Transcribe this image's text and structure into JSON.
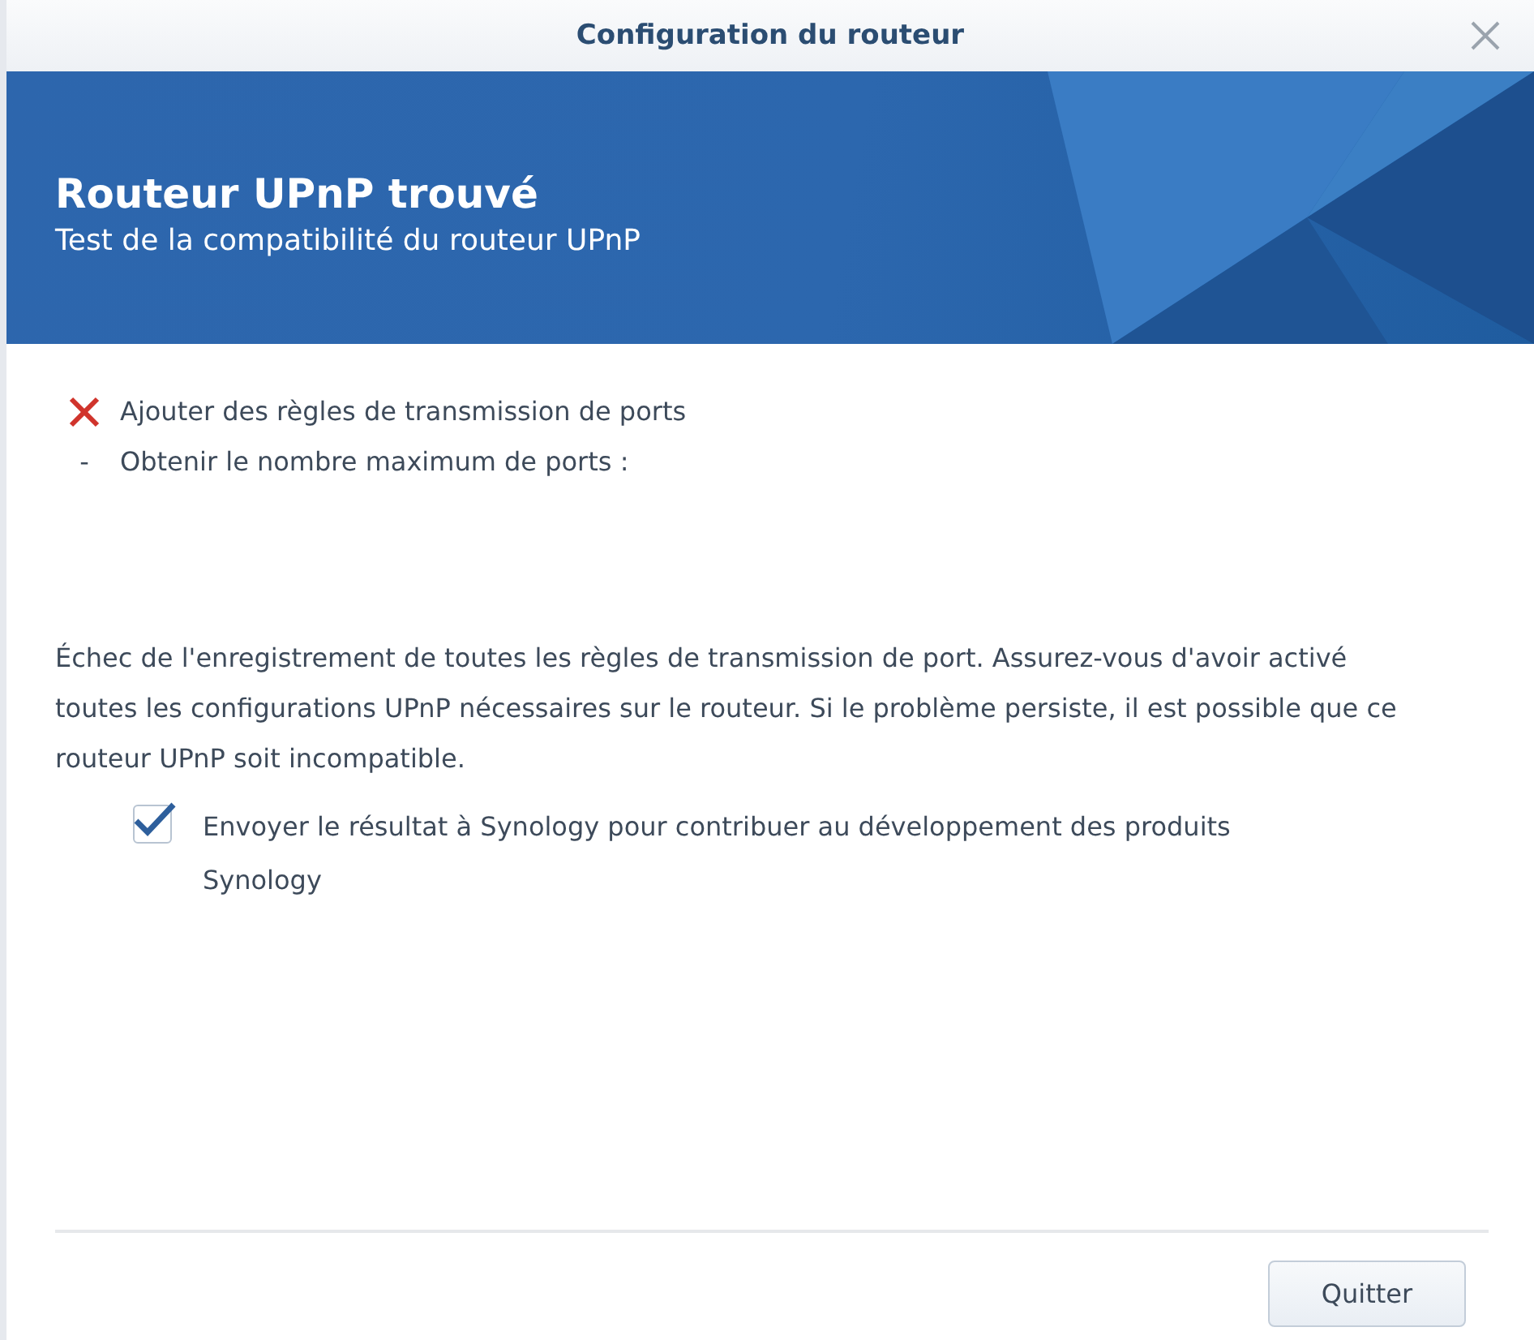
{
  "window": {
    "title": "Configuration du routeur"
  },
  "banner": {
    "title": "Routeur UPnP trouvé",
    "subtitle": "Test de la compatibilité du routeur UPnP"
  },
  "steps": [
    {
      "kind": "fail",
      "label": "Ajouter des règles de transmission de ports"
    },
    {
      "kind": "pending",
      "marker": "-",
      "label": "Obtenir le nombre maximum de ports :"
    }
  ],
  "message": "Échec de l'enregistrement de toutes les règles de transmission de port. Assurez-vous d'avoir activé toutes les configurations UPnP nécessaires sur le routeur. Si le problème persiste, il est possible que ce routeur UPnP soit incompatible.",
  "feedback": {
    "label": "Envoyer le résultat à Synology pour contribuer au développement des produits Synology",
    "checked": true
  },
  "buttons": [
    {
      "label": "Quitter"
    }
  ]
}
